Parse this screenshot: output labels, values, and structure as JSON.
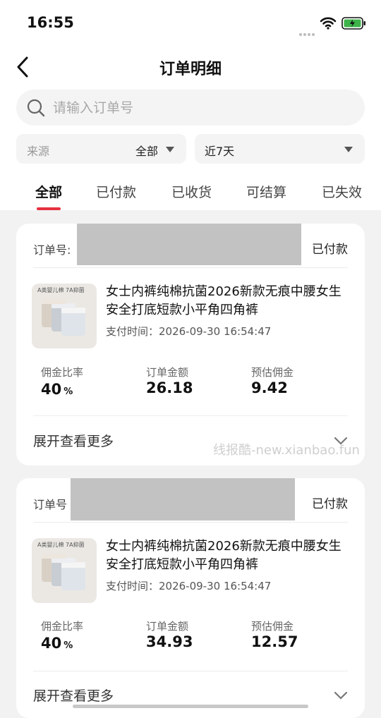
{
  "status_bar": {
    "time": "16:55"
  },
  "header": {
    "title": "订单明细"
  },
  "search": {
    "placeholder": "请输入订单号"
  },
  "filters": {
    "source_label": "来源",
    "source_value": "全部",
    "time_value": "近7天"
  },
  "tabs": [
    {
      "label": "全部",
      "active": true
    },
    {
      "label": "已付款",
      "active": false
    },
    {
      "label": "已收货",
      "active": false
    },
    {
      "label": "可结算",
      "active": false
    },
    {
      "label": "已失效",
      "active": false
    }
  ],
  "orders": [
    {
      "order_label": "订单号:",
      "status": "已付款",
      "image_tag": "A类婴儿棉 7A抑菌",
      "product_title": "女士内裤纯棉抗菌2026新款无痕中腰女生安全打底短款小平角四角裤",
      "pay_time": "支付时间：2026-09-30 16:54:47",
      "rate_label": "佣金比率",
      "rate_value": "40",
      "rate_unit": "%",
      "amount_label": "订单金额",
      "amount_value": "26.18",
      "commission_label": "预估佣金",
      "commission_value": "9.42",
      "expand_label": "展开查看更多"
    },
    {
      "order_label": "订单号",
      "status": "已付款",
      "image_tag": "A类婴儿棉 7A抑菌",
      "product_title": "女士内裤纯棉抗菌2026新款无痕中腰女生安全打底短款小平角四角裤",
      "pay_time": "支付时间：2026-09-30 16:54:47",
      "rate_label": "佣金比率",
      "rate_value": "40",
      "rate_unit": "%",
      "amount_label": "订单金额",
      "amount_value": "34.93",
      "commission_label": "预估佣金",
      "commission_value": "12.57",
      "expand_label": "展开查看更多"
    }
  ],
  "watermark": "线报酷-new.xianbao.fun",
  "colors": {
    "accent": "#e6313f",
    "background": "#f2f2f2"
  }
}
